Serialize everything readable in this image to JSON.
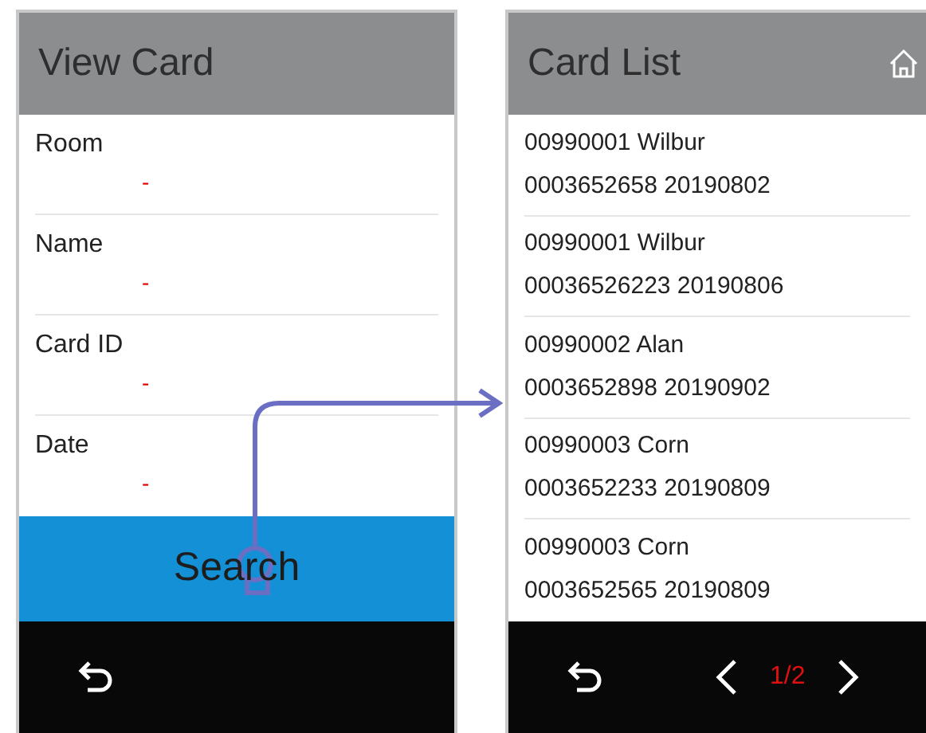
{
  "view_card": {
    "title": "View Card",
    "fields": [
      {
        "label": "Room",
        "value": "-"
      },
      {
        "label": "Name",
        "value": "-"
      },
      {
        "label": "Card ID",
        "value": "-"
      },
      {
        "label": "Date",
        "value": "-"
      }
    ],
    "search_button": "Search"
  },
  "card_list": {
    "title": "Card List",
    "rows": [
      {
        "line_1": "00990001 Wilbur",
        "line_2": "0003652658 20190802"
      },
      {
        "line_1": "00990001 Wilbur",
        "line_2": "00036526223 20190806"
      },
      {
        "line_1": "00990002 Alan",
        "line_2": "0003652898 20190902"
      },
      {
        "line_1": "00990003 Corn",
        "line_2": "0003652233 20190809"
      },
      {
        "line_1": "00990003 Corn",
        "line_2": "0003652565 20190809"
      }
    ],
    "page": "1/2"
  }
}
